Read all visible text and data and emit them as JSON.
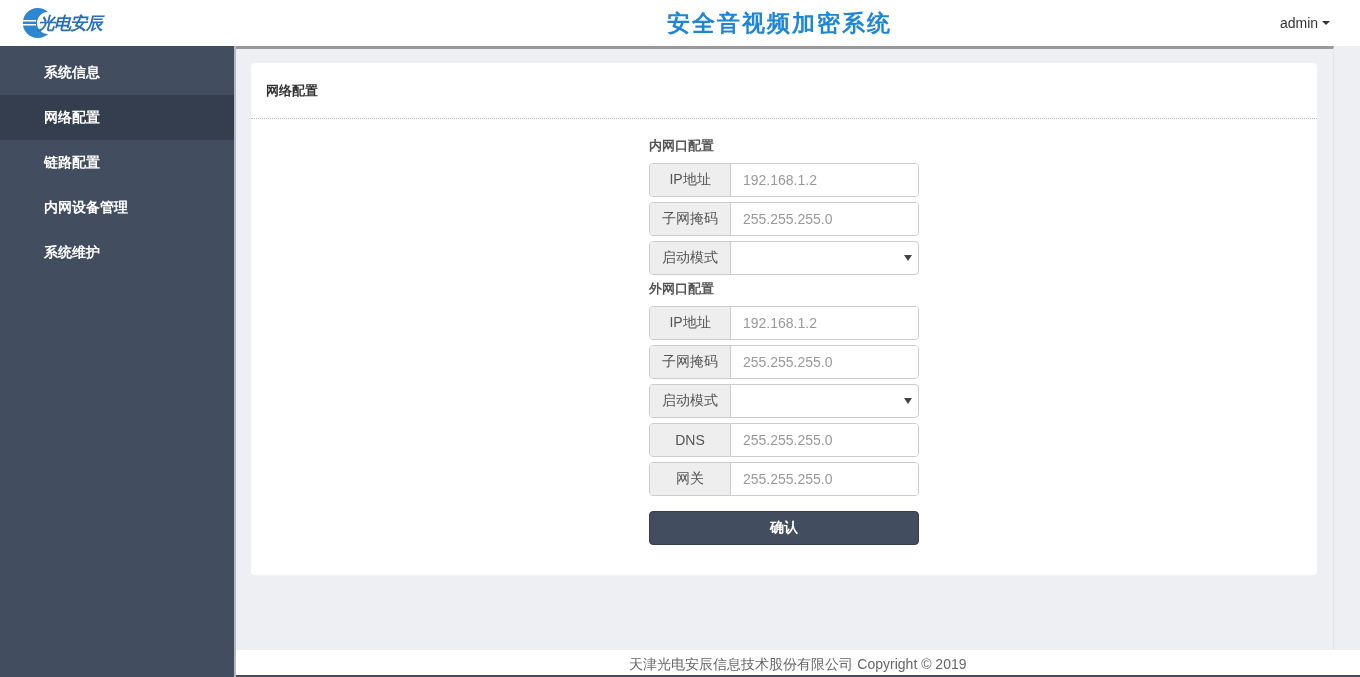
{
  "header": {
    "logo_text": "光电安辰",
    "title": "安全音视频加密系统",
    "user": "admin"
  },
  "sidebar": {
    "items": [
      {
        "label": "系统信息",
        "selected": false
      },
      {
        "label": "网络配置",
        "selected": true
      },
      {
        "label": "链路配置",
        "selected": false
      },
      {
        "label": "内网设备管理",
        "selected": false
      },
      {
        "label": "系统维护",
        "selected": false
      }
    ]
  },
  "panel": {
    "title": "网络配置",
    "sections": [
      {
        "title": "内网口配置",
        "fields": [
          {
            "kind": "input",
            "label": "IP地址",
            "placeholder": "192.168.1.2"
          },
          {
            "kind": "input",
            "label": "子网掩码",
            "placeholder": "255.255.255.0"
          },
          {
            "kind": "select",
            "label": "启动模式"
          }
        ]
      },
      {
        "title": "外网口配置",
        "fields": [
          {
            "kind": "input",
            "label": "IP地址",
            "placeholder": "192.168.1.2"
          },
          {
            "kind": "input",
            "label": "子网掩码",
            "placeholder": "255.255.255.0"
          },
          {
            "kind": "select",
            "label": "启动模式"
          },
          {
            "kind": "input",
            "label": "DNS",
            "placeholder": "255.255.255.0"
          },
          {
            "kind": "input",
            "label": "网关",
            "placeholder": "255.255.255.0"
          }
        ]
      }
    ],
    "submit": "确认"
  },
  "footer": "天津光电安辰信息技术股份有限公司 Copyright © 2019"
}
